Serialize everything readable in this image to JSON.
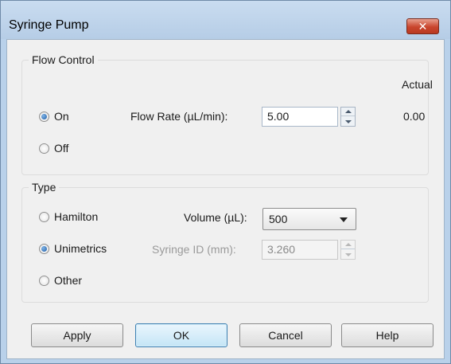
{
  "window": {
    "title": "Syringe Pump",
    "close_label": "✕"
  },
  "flow_control": {
    "group_label": "Flow Control",
    "actual_header": "Actual",
    "on_label": "On",
    "off_label": "Off",
    "selected": "On",
    "flow_rate_label": "Flow Rate (µL/min):",
    "flow_rate_value": "5.00",
    "actual_value": "0.00"
  },
  "type": {
    "group_label": "Type",
    "hamilton_label": "Hamilton",
    "unimetrics_label": "Unimetrics",
    "other_label": "Other",
    "selected": "Unimetrics",
    "volume_label": "Volume (µL):",
    "volume_value": "500",
    "syringe_id_label": "Syringe ID (mm):",
    "syringe_id_value": "3.260"
  },
  "buttons": {
    "apply": "Apply",
    "ok": "OK",
    "cancel": "Cancel",
    "help": "Help"
  },
  "colors": {
    "window_frame": "#b9d1ea",
    "close_button": "#c9452d",
    "dialog_background": "#f0f0f0",
    "default_button": "#c4e5f6"
  }
}
